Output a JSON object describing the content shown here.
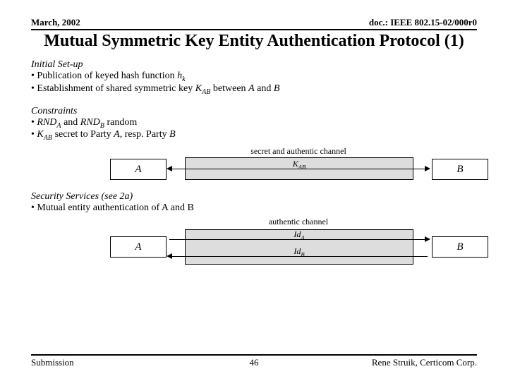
{
  "header": {
    "left": "March, 2002",
    "right": "doc.: IEEE 802.15-02/000r0"
  },
  "title": "Mutual Symmetric Key Entity Authentication Protocol (1)",
  "initial_setup": {
    "head": "Initial Set-up",
    "b1_prefix": "• Publication of keyed hash function ",
    "b1_h": "h",
    "b1_sub": "k",
    "b2_prefix": "• Establishment of shared symmetric key ",
    "b2_k": "K",
    "b2_sub": "AB",
    "b2_mid": " between ",
    "b2_A": "A",
    "b2_and": " and ",
    "b2_B": "B"
  },
  "constraints": {
    "head": "Constraints",
    "b1_prefix": "• ",
    "b1_r1": "RND",
    "b1_s1": "A",
    "b1_and": " and ",
    "b1_r2": "RND",
    "b1_s2": "B",
    "b1_suffix": " random",
    "b2_prefix": "• ",
    "b2_k": "K",
    "b2_ks": "AB",
    "b2_mid": " secret to Party ",
    "b2_A": "A",
    "b2_resp": ", resp. Party ",
    "b2_B": "B"
  },
  "diagram1": {
    "caption": "secret and authentic channel",
    "A": "A",
    "B": "B",
    "key_k": "K",
    "key_sub": "AB"
  },
  "security": {
    "head": "Security Services (see 2a)",
    "b1": "• Mutual entity authentication of A and B"
  },
  "diagram2": {
    "caption": "authentic channel",
    "A": "A",
    "B": "B",
    "idA_i": "Id",
    "idA_s": "A",
    "idB_i": "Id",
    "idB_s": "B"
  },
  "footer": {
    "left": "Submission",
    "center": "46",
    "right": "Rene Struik, Certicom Corp."
  }
}
